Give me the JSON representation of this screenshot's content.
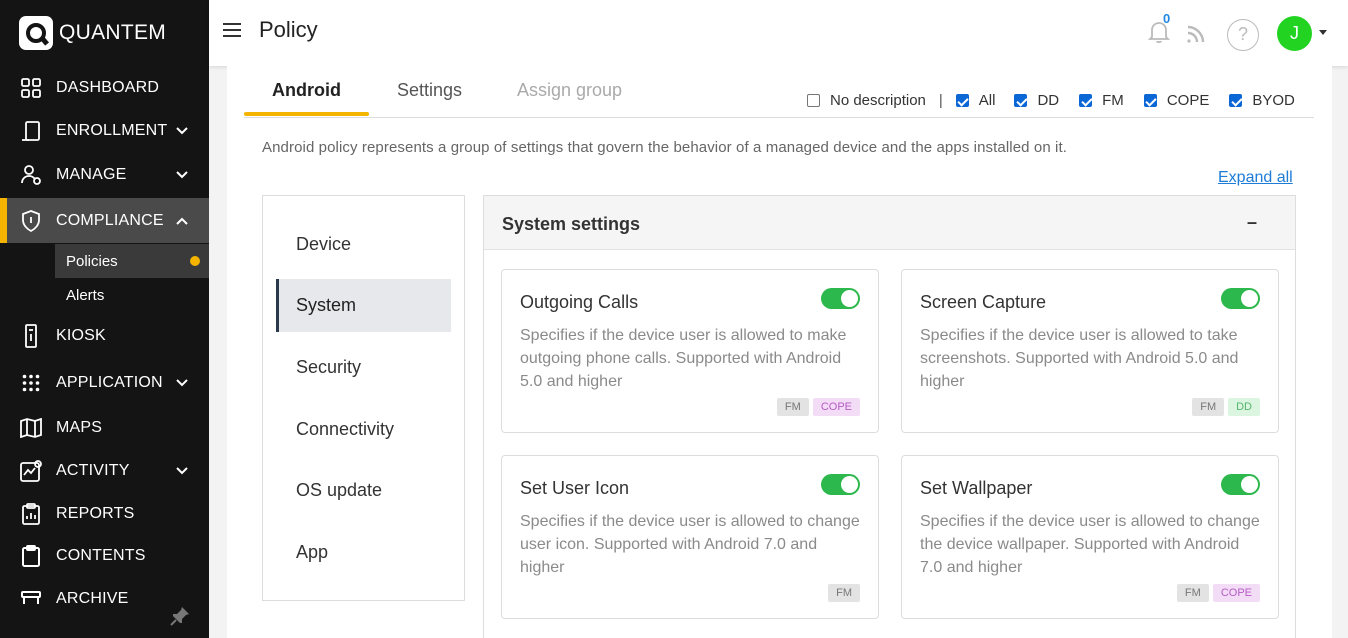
{
  "brand": {
    "name": "QUANTEM"
  },
  "sidebar": {
    "items": [
      {
        "label": "DASHBOARD",
        "icon": "dashboard-icon"
      },
      {
        "label": "ENROLLMENT",
        "icon": "enrollment-icon",
        "expandable": true
      },
      {
        "label": "MANAGE",
        "icon": "manage-user-icon",
        "expandable": true
      },
      {
        "label": "COMPLIANCE",
        "icon": "shield-icon",
        "expandable": true,
        "expanded": true,
        "active": true
      },
      {
        "label": "KIOSK",
        "icon": "kiosk-icon"
      },
      {
        "label": "APPLICATION",
        "icon": "apps-grid-icon",
        "expandable": true
      },
      {
        "label": "MAPS",
        "icon": "map-icon"
      },
      {
        "label": "ACTIVITY",
        "icon": "activity-icon",
        "expandable": true
      },
      {
        "label": "REPORTS",
        "icon": "reports-icon"
      },
      {
        "label": "CONTENTS",
        "icon": "clipboard-icon"
      },
      {
        "label": "ARCHIVE",
        "icon": "archive-icon"
      }
    ],
    "compliance_sub": [
      {
        "label": "Policies",
        "current": true
      },
      {
        "label": "Alerts"
      }
    ]
  },
  "header": {
    "title": "Policy",
    "notification_count": "0",
    "help": "?",
    "avatar_initial": "J"
  },
  "tabs": [
    {
      "label": "Android",
      "active": true
    },
    {
      "label": "Settings"
    },
    {
      "label": "Assign group",
      "disabled": true
    }
  ],
  "filters": {
    "no_description": {
      "label": "No description",
      "checked": false
    },
    "separator": "|",
    "items": [
      {
        "label": "All",
        "checked": true
      },
      {
        "label": "DD",
        "checked": true
      },
      {
        "label": "FM",
        "checked": true
      },
      {
        "label": "COPE",
        "checked": true
      },
      {
        "label": "BYOD",
        "checked": true
      }
    ]
  },
  "description": "Android policy represents a group of settings that govern the behavior of a managed device and the apps installed on it.",
  "expand_all": "Expand all",
  "subnav": [
    {
      "label": "Device"
    },
    {
      "label": "System",
      "selected": true
    },
    {
      "label": "Security"
    },
    {
      "label": "Connectivity"
    },
    {
      "label": "OS update"
    },
    {
      "label": "App"
    }
  ],
  "settings": {
    "title": "System settings",
    "collapse": "–",
    "cards": [
      {
        "title": "Outgoing Calls",
        "enabled": true,
        "description": "Specifies if the device user is allowed to make outgoing phone calls. Supported with Android 5.0 and higher",
        "tags": [
          "FM",
          "COPE"
        ]
      },
      {
        "title": "Screen Capture",
        "enabled": true,
        "description": "Specifies if the device user is allowed to take screenshots. Supported with Android 5.0 and higher",
        "tags": [
          "FM",
          "DD"
        ]
      },
      {
        "title": "Set User Icon",
        "enabled": true,
        "description": "Specifies if the device user is allowed to change user icon. Supported with Android 7.0 and higher",
        "tags": [
          "FM"
        ]
      },
      {
        "title": "Set Wallpaper",
        "enabled": true,
        "description": "Specifies if the device user is allowed to change the device wallpaper. Supported with Android 7.0 and higher",
        "tags": [
          "FM",
          "COPE"
        ]
      }
    ]
  },
  "colors": {
    "accent": "#f4b400",
    "sidebar_bg": "#141414",
    "toggle_on": "#2db84d",
    "link": "#1e7bd6",
    "avatar": "#22d322"
  }
}
